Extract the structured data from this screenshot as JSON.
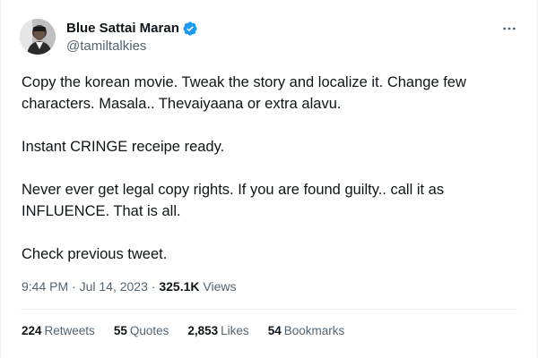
{
  "author": {
    "display_name": "Blue Sattai Maran",
    "handle": "@tamiltalkies",
    "verified": true,
    "avatar_icon": "user-avatar-icon"
  },
  "tweet": {
    "paragraphs": [
      "Copy the korean movie. Tweak the story and localize it. Change few characters. Masala.. Thevaiyaana or extra alavu.",
      "Instant CRINGE receipe ready.",
      "Never ever get legal copy rights. If you are found guilty.. call it as INFLUENCE. That is all.",
      "Check previous tweet."
    ]
  },
  "meta": {
    "time": "9:44 PM",
    "separator": "·",
    "date": "Jul 14, 2023",
    "views_count": "325.1K",
    "views_label": "Views"
  },
  "stats": [
    {
      "count": "224",
      "label": "Retweets"
    },
    {
      "count": "55",
      "label": "Quotes"
    },
    {
      "count": "2,853",
      "label": "Likes"
    },
    {
      "count": "54",
      "label": "Bookmarks"
    }
  ],
  "colors": {
    "verified_badge": "#1d9bf0",
    "secondary_text": "#536471",
    "primary_text": "#0f1419"
  }
}
